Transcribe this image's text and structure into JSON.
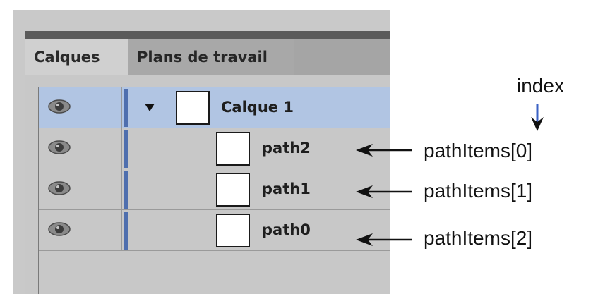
{
  "panel": {
    "tabs": [
      {
        "label": "Calques",
        "active": true
      },
      {
        "label": "Plans de travail",
        "active": false
      }
    ],
    "layer_color": "#4f6fae",
    "selection_color": "#b1c5e3",
    "rows": [
      {
        "label": "Calque 1",
        "type": "layer",
        "expanded": true,
        "selected": true,
        "visible": true
      },
      {
        "label": "path2",
        "type": "path",
        "selected": false,
        "visible": true
      },
      {
        "label": "path1",
        "type": "path",
        "selected": false,
        "visible": true
      },
      {
        "label": "path0",
        "type": "path",
        "selected": false,
        "visible": true
      }
    ]
  },
  "annotations": {
    "index_label": "index",
    "items": [
      {
        "label": "pathItems[0]",
        "target": "path2"
      },
      {
        "label": "pathItems[1]",
        "target": "path1"
      },
      {
        "label": "pathItems[2]",
        "target": "path0"
      }
    ]
  },
  "icons": {
    "visibility": "eye-icon",
    "expand": "triangle-down-icon",
    "pointer": "arrow-left-icon",
    "index_pointer": "arrow-down-icon"
  }
}
